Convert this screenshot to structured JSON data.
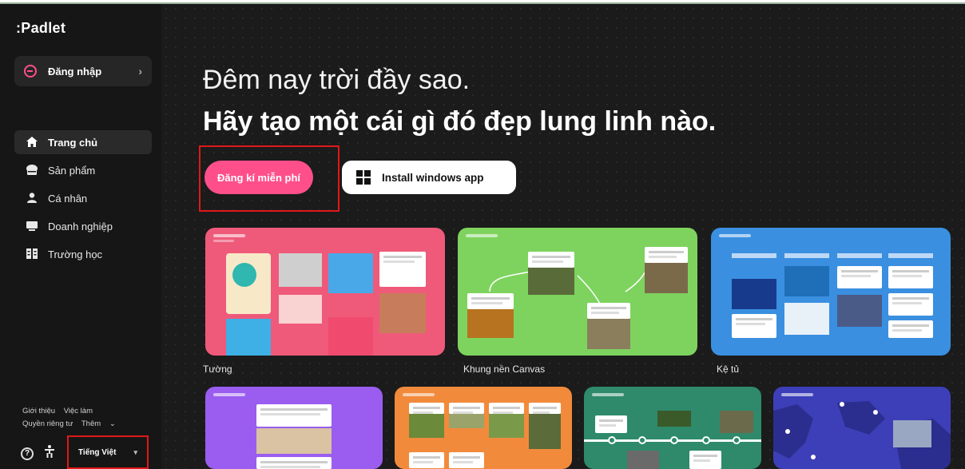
{
  "app": {
    "logo": ":Padlet"
  },
  "sidebar": {
    "login_label": "Đăng nhập",
    "items": [
      {
        "label": "Trang chủ",
        "icon": "home-icon",
        "active": true
      },
      {
        "label": "Sản phẩm",
        "icon": "product-icon",
        "active": false
      },
      {
        "label": "Cá nhân",
        "icon": "person-icon",
        "active": false
      },
      {
        "label": "Doanh nghiệp",
        "icon": "business-icon",
        "active": false
      },
      {
        "label": "Trường học",
        "icon": "school-icon",
        "active": false
      }
    ],
    "footer": {
      "about": "Giới thiệu",
      "jobs": "Việc làm",
      "privacy": "Quyền riêng tư",
      "more": "Thêm"
    },
    "language": "Tiếng Việt"
  },
  "hero": {
    "line1": "Đêm nay trời đầy sao.",
    "line2": "Hãy tạo một cái gì đó đẹp lung linh nào.",
    "signup_label": "Đăng kí miễn phí",
    "install_label": "Install windows app"
  },
  "templates": [
    {
      "name": "Tường",
      "color": "#ef5a7a"
    },
    {
      "name": "Khung nền Canvas",
      "color": "#7ed35e"
    },
    {
      "name": "Kệ tủ",
      "color": "#3a8fe0"
    },
    {
      "name": "",
      "color": "#9a5df0"
    },
    {
      "name": "",
      "color": "#f28a3c"
    },
    {
      "name": "",
      "color": "#2e8a6a"
    },
    {
      "name": "",
      "color": "#3d3fb8"
    }
  ],
  "colors": {
    "accent": "#ff4f8b",
    "highlight_box": "#e01818"
  }
}
